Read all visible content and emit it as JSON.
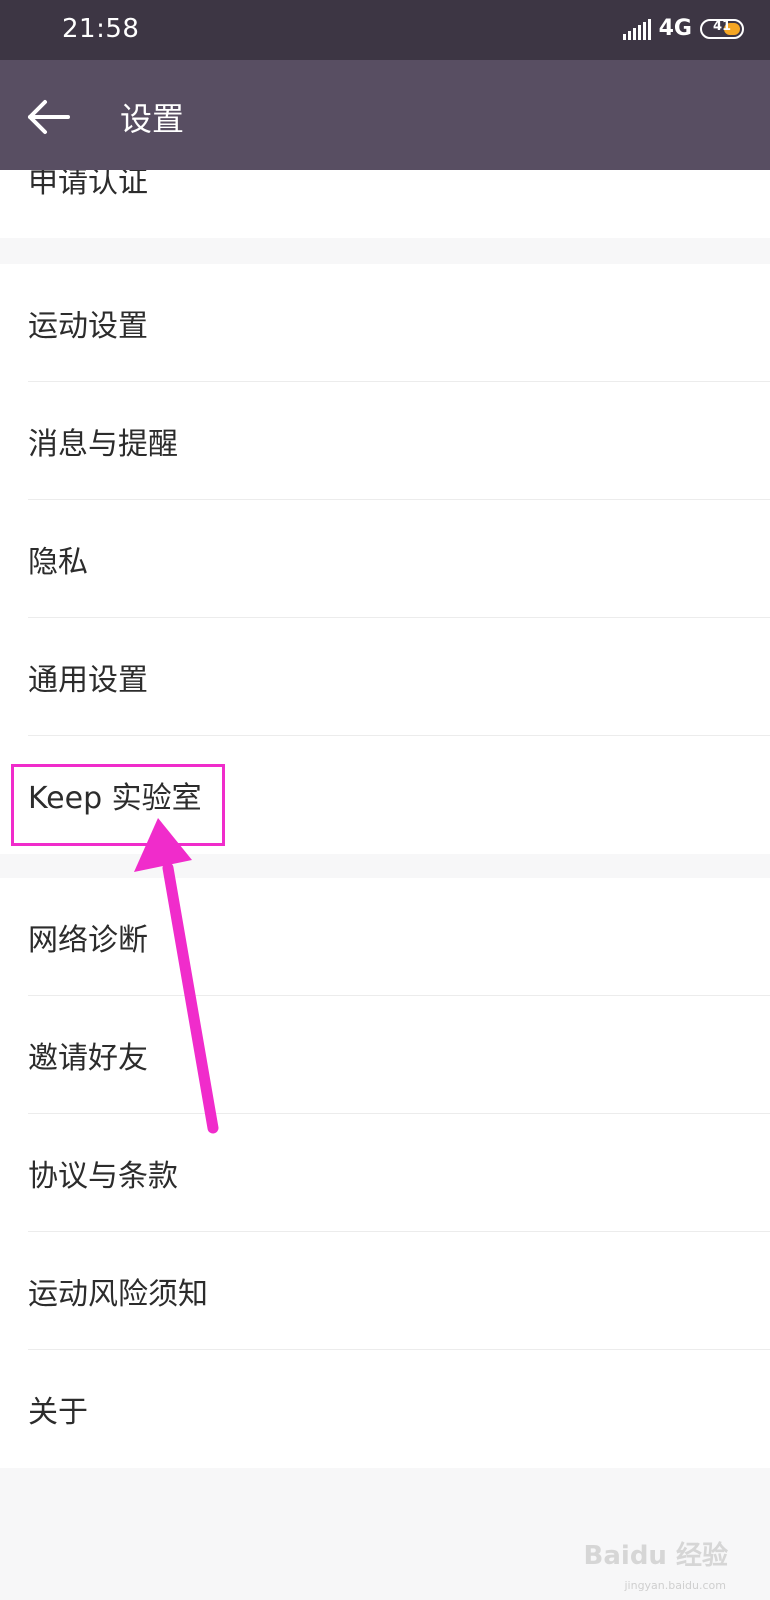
{
  "status_bar": {
    "time": "21:58",
    "network": "4G",
    "battery": "41"
  },
  "header": {
    "title": "设置"
  },
  "groups": [
    {
      "items": [
        "申请认证"
      ]
    },
    {
      "items": [
        "运动设置",
        "消息与提醒",
        "隐私",
        "通用设置",
        "Keep 实验室"
      ]
    },
    {
      "items": [
        "网络诊断",
        "邀请好友",
        "协议与条款",
        "运动风险须知",
        "关于"
      ]
    }
  ],
  "annotation": {
    "color": "#f02ccb"
  },
  "watermark": {
    "main": "Baidu 经验",
    "sub": "jingyan.baidu.com"
  }
}
